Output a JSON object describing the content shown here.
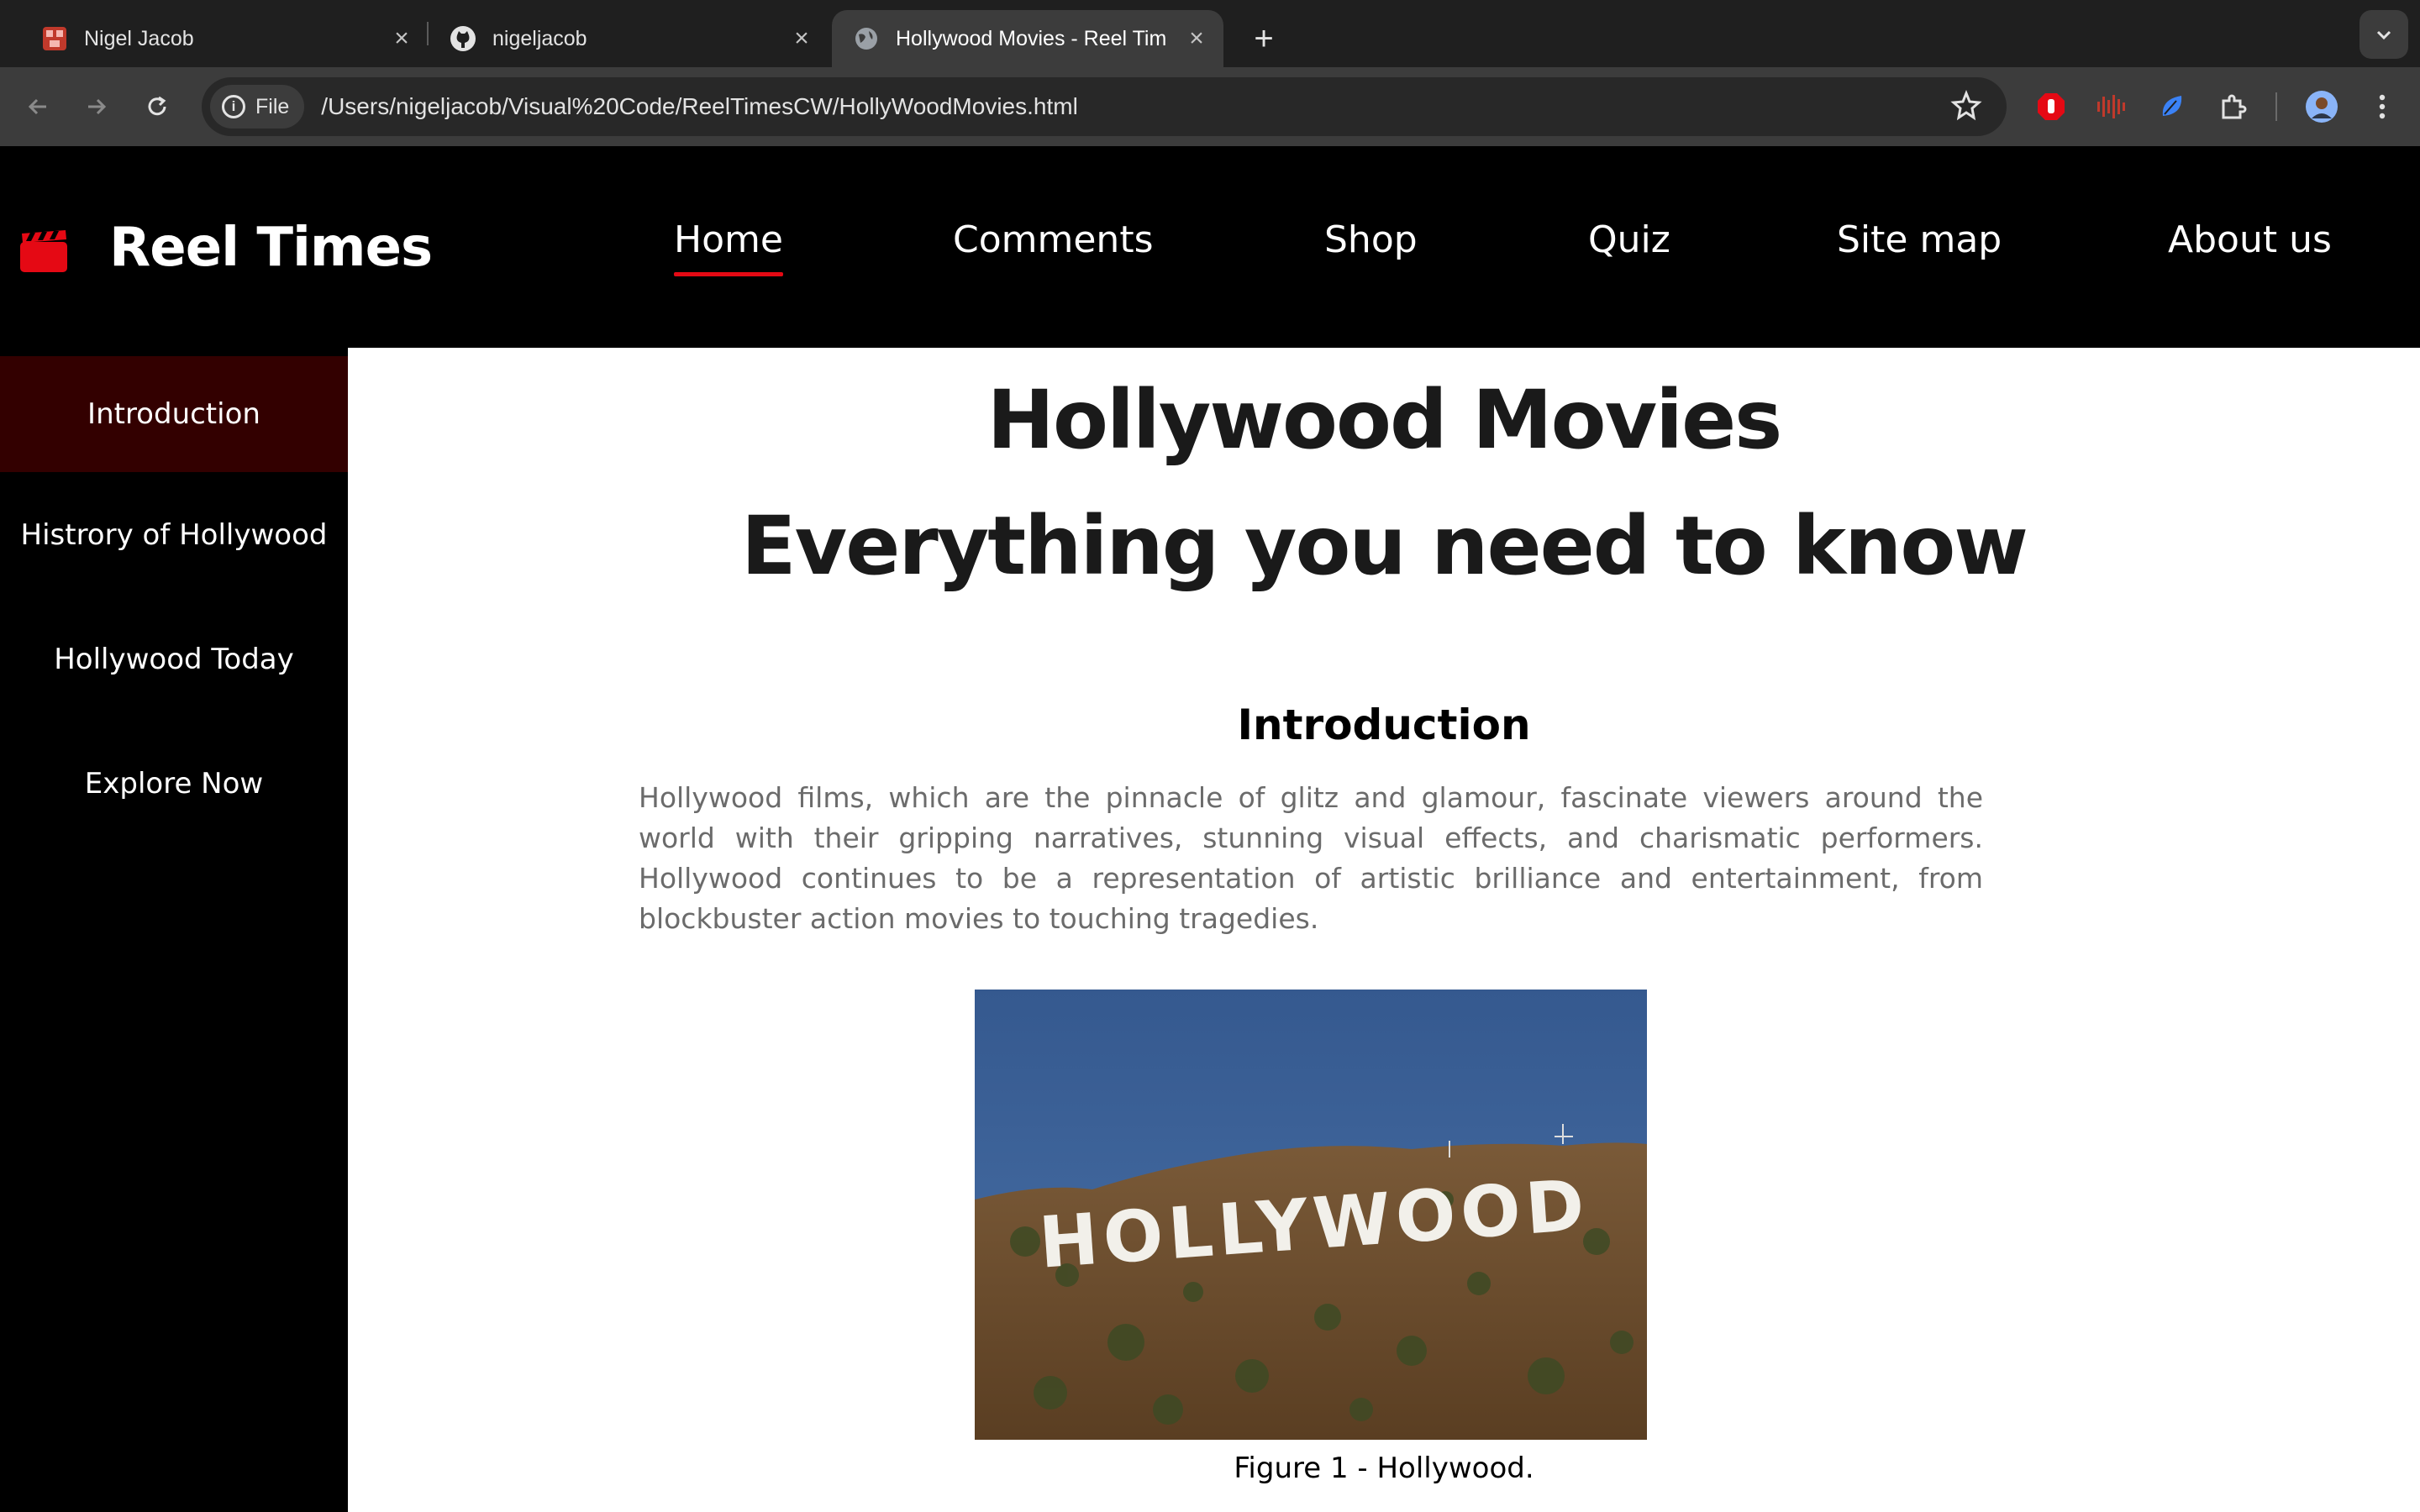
{
  "browser": {
    "tabs": [
      {
        "title": "Nigel Jacob",
        "icon": "profile-favicon",
        "active": false
      },
      {
        "title": "nigeljacob",
        "icon": "github-icon",
        "active": false
      },
      {
        "title": "Hollywood Movies - Reel Tim",
        "icon": "globe-icon",
        "active": true
      }
    ],
    "new_tab_symbol": "+",
    "close_symbol": "×",
    "address_chip": "File",
    "url": "/Users/nigeljacob/Visual%20Code/ReelTimesCW/HollyWoodMovies.html"
  },
  "site": {
    "logo_text": "Reel Times",
    "brand_color": "#e50914",
    "nav": [
      {
        "label": "Home",
        "active": true
      },
      {
        "label": "Comments",
        "active": false
      },
      {
        "label": "Shop",
        "active": false
      },
      {
        "label": "Quiz",
        "active": false
      },
      {
        "label": "Site map",
        "active": false
      },
      {
        "label": "About us",
        "active": false
      }
    ]
  },
  "sidebar": {
    "items": [
      {
        "label": "Introduction",
        "active": true
      },
      {
        "label": "Histrory of Hollywood",
        "active": false
      },
      {
        "label": "Hollywood Today",
        "active": false
      },
      {
        "label": "Explore Now",
        "active": false
      }
    ]
  },
  "main": {
    "title_line1": "Hollywood Movies",
    "title_line2": "Everything you need to know",
    "section_heading": "Introduction",
    "paragraph": "Hollywood films, which are the pinnacle of glitz and glamour, fascinate viewers around the world with their gripping narratives, stunning visual effects, and charismatic performers. Hollywood continues to be a representation of artistic brilliance and entertainment, from blockbuster action movies to touching tragedies.",
    "figure_sign_text": "HOLLYWOOD",
    "figure_caption": "Figure 1 - Hollywood."
  }
}
